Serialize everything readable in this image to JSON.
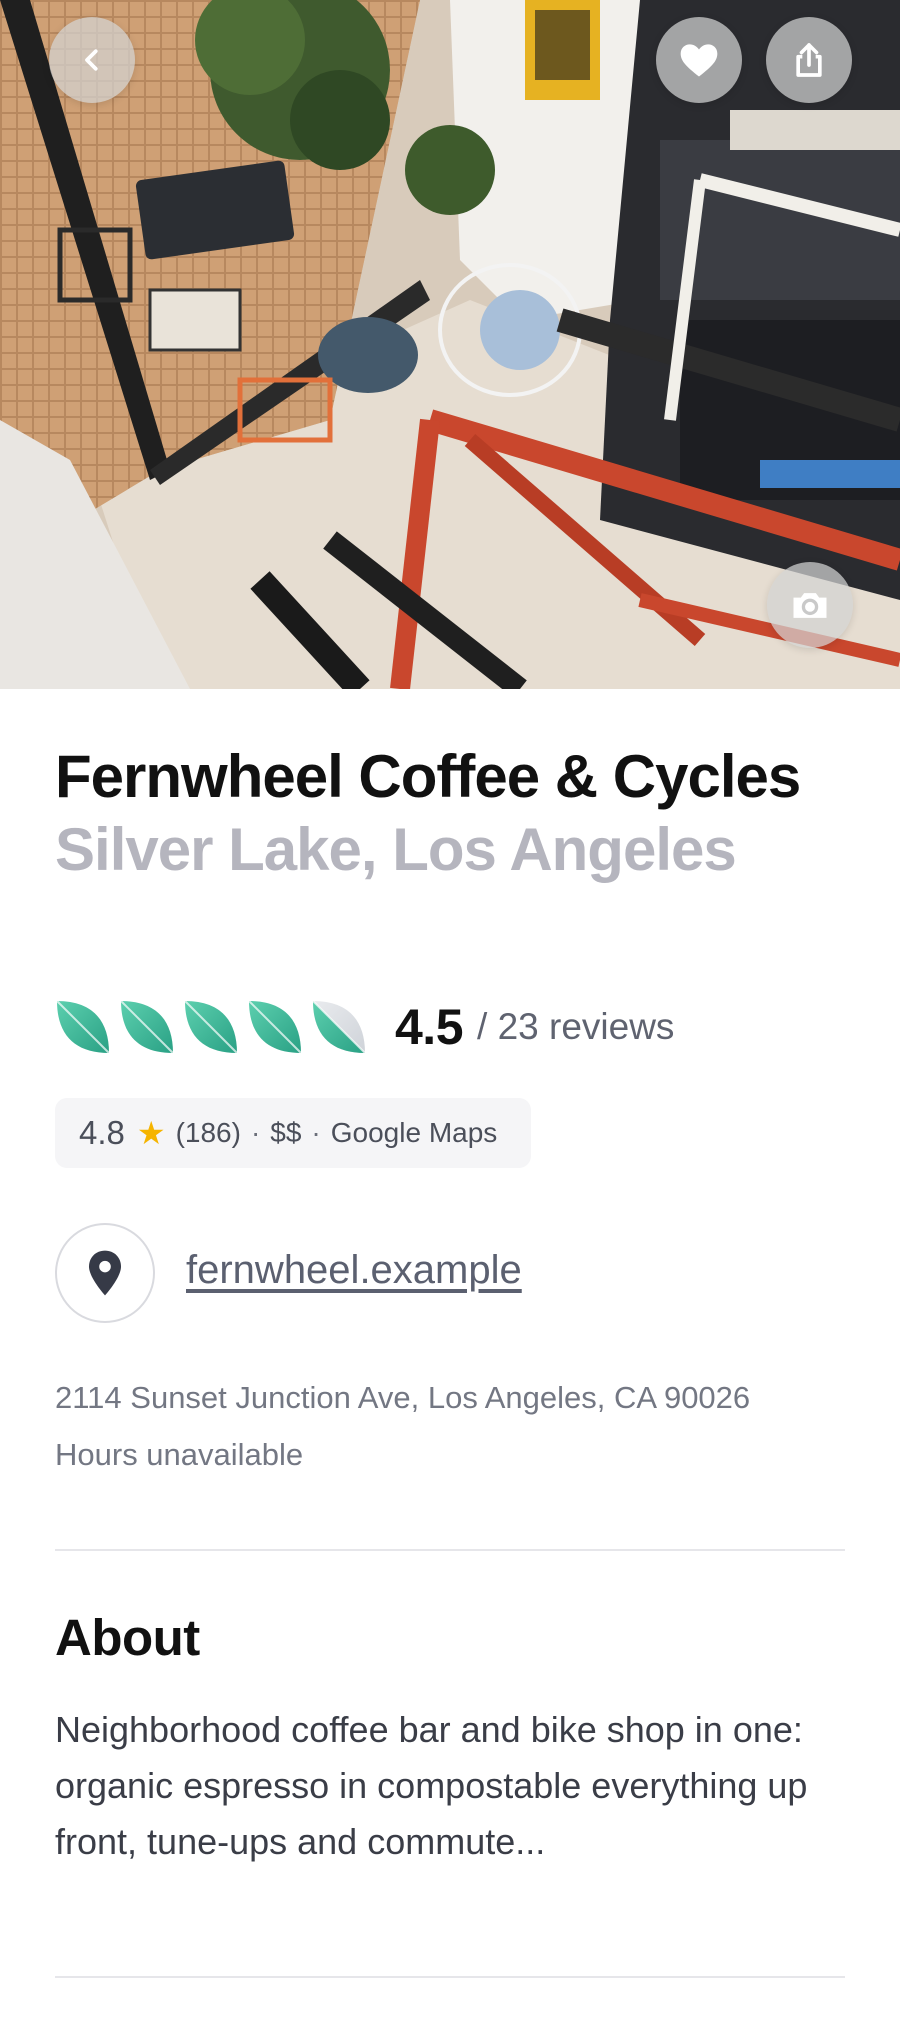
{
  "place": {
    "name": "Fernwheel Coffee & Cycles",
    "location": "Silver Lake, Los Angeles"
  },
  "rating": {
    "leaves_total": 5,
    "score": "4.5",
    "reviews_text": "/ 23 reviews"
  },
  "google_maps": {
    "score": "4.8",
    "count": "(186)",
    "separator": "·",
    "price": "$$",
    "source": "Google Maps"
  },
  "website": {
    "label": "fernwheel.example"
  },
  "address": "2114 Sunset Junction Ave, Los Angeles, CA 90026",
  "hours": "Hours unavailable",
  "about": {
    "heading": "About",
    "text": "Neighborhood coffee bar and bike shop in one: organic espresso in compostable everything up front, tune-ups and commute..."
  },
  "icons": {
    "back": "chevron-left-icon",
    "favorite": "heart-icon",
    "share": "share-icon",
    "photos": "camera-icon",
    "rating_leaf": "leaf-icon",
    "star": "star-icon",
    "location": "map-pin-icon"
  },
  "colors": {
    "leaf_fill": "#3fb79a",
    "star": "#f5b400",
    "location_muted": "#b5b5be"
  }
}
